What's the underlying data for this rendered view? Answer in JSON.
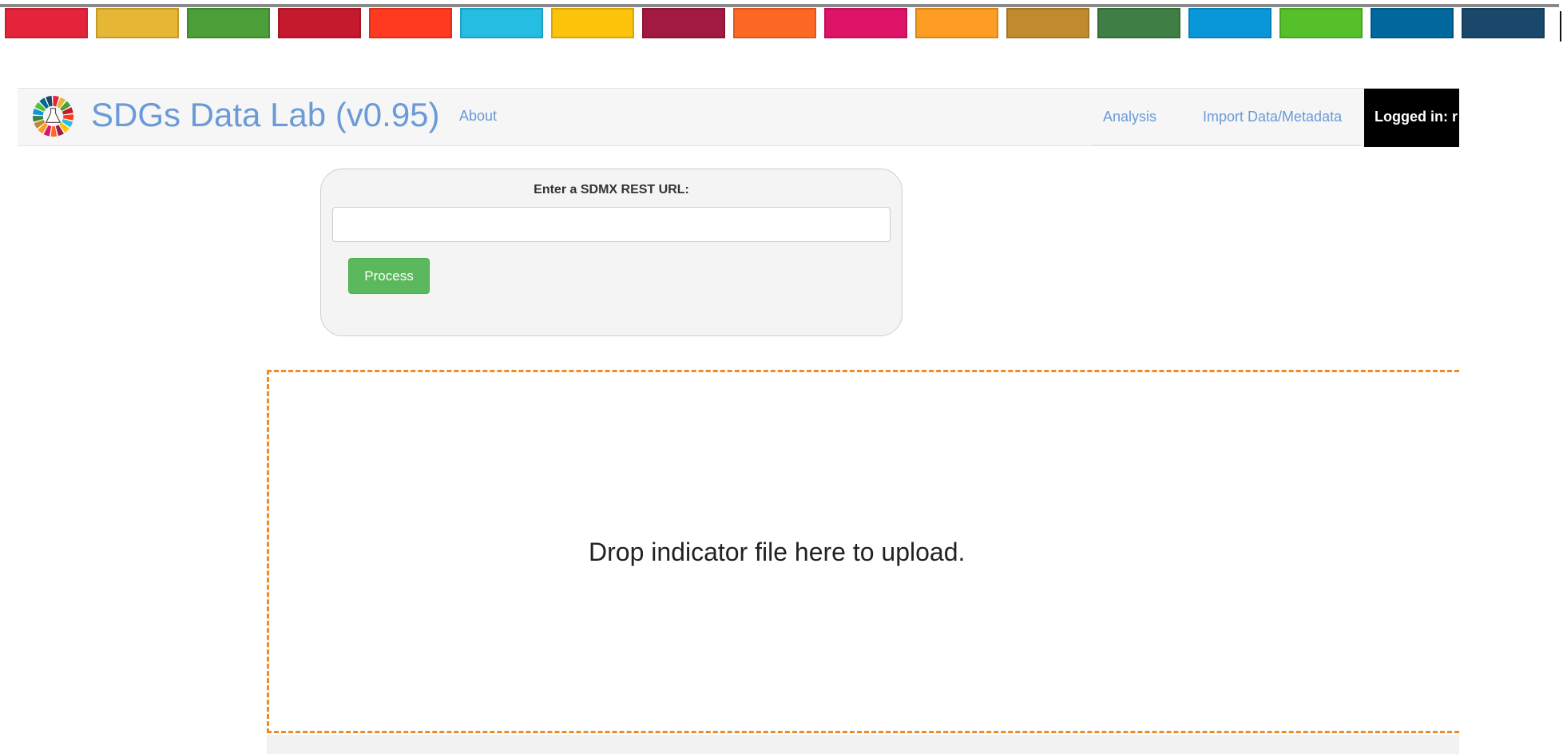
{
  "sdg_strip": {
    "colors": [
      "#e5243b",
      "#e5b735",
      "#4c9f38",
      "#c5192d",
      "#ff3a21",
      "#26bde2",
      "#fcc30b",
      "#a21942",
      "#fd6925",
      "#dd1367",
      "#fd9d24",
      "#bf8b2e",
      "#3f7e44",
      "#0a97d9",
      "#56c02b",
      "#00689d",
      "#19486a"
    ]
  },
  "header": {
    "title": "SDGs Data Lab (v0.95)",
    "about_label": "About",
    "nav": {
      "analysis_label": "Analysis",
      "import_label": "Import Data/Metadata"
    },
    "logged_in_label": "Logged in: r"
  },
  "sdmx_form": {
    "label": "Enter a SDMX REST URL:",
    "url_value": "",
    "process_label": "Process"
  },
  "dropzone": {
    "text": "Drop indicator file here to upload."
  },
  "colors": {
    "link": "#6a9ad8",
    "accent_orange": "#f08a24",
    "button_green": "#5cb85c"
  }
}
